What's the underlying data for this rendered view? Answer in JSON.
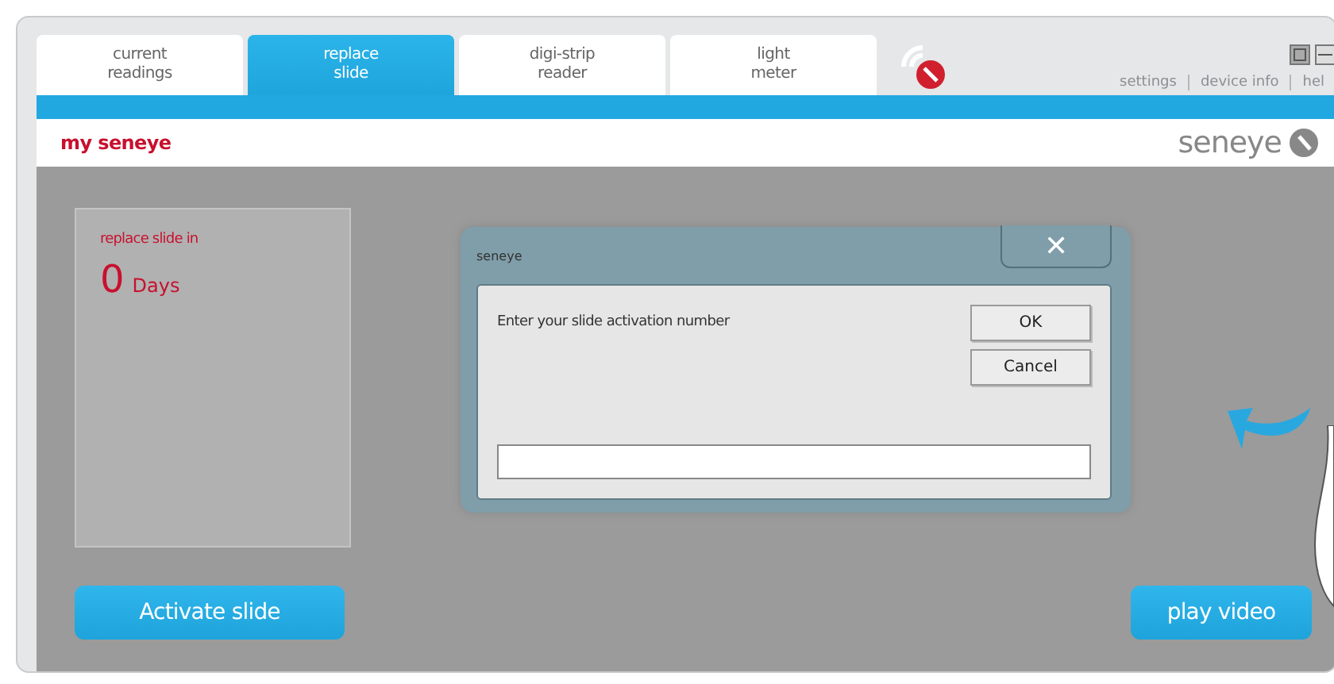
{
  "tabs": [
    {
      "label": "current\nreadings",
      "selected": false
    },
    {
      "label": "replace\nslide",
      "selected": true
    },
    {
      "label": "digi-strip\nreader",
      "selected": false
    },
    {
      "label": "light\nmeter",
      "selected": false
    }
  ],
  "links": [
    "settings",
    "device info",
    "hel"
  ],
  "header": {
    "title": "my seneye",
    "logo": "seneye"
  },
  "slide_card": {
    "label": "replace slide in",
    "value": "0",
    "unit": "Days"
  },
  "activate_button": "Activate slide",
  "play_button": "play video",
  "dialog": {
    "title": "seneye",
    "close": "✕",
    "prompt": "Enter your slide activation number",
    "buttons": [
      "OK",
      "Cancel"
    ]
  }
}
